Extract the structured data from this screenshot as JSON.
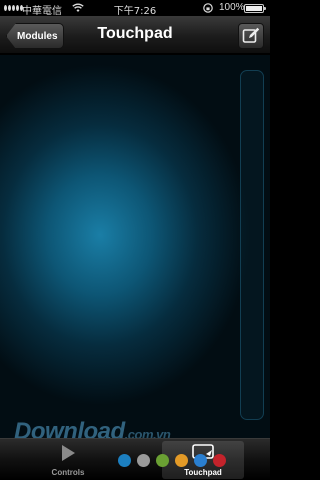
{
  "status_bar": {
    "carrier": "中華電信",
    "time": "下午7:26",
    "battery_percent": "100%",
    "battery_level": 1.0
  },
  "nav": {
    "back_label": "Modules",
    "title": "Touchpad",
    "edit_icon": "edit-icon"
  },
  "watermark": {
    "text": "Download",
    "domain": ".com.vn"
  },
  "tab_bar": {
    "tabs": [
      {
        "label": "Controls",
        "icon": "play-icon",
        "selected": false
      },
      {
        "label": "Touchpad",
        "icon": "touchpad-icon",
        "selected": true
      }
    ],
    "dot_colors": [
      "#1c7fc0",
      "#9a9a9a",
      "#6aa033",
      "#e39a27",
      "#2a7fd0",
      "#c4232b"
    ]
  }
}
